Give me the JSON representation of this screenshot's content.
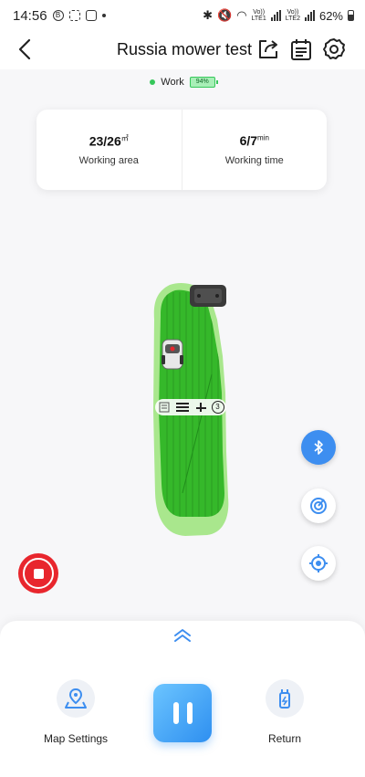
{
  "status_bar": {
    "time": "14:56",
    "battery_percent": "62%",
    "sim1_label": "Vo))\nLTE1",
    "sim2_label": "Vo))\nLTE2"
  },
  "header": {
    "title": "Russia mower test",
    "back_icon": "chevron-left-icon",
    "share_icon": "share-icon",
    "schedule_icon": "schedule-icon",
    "settings_icon": "gear-icon"
  },
  "device_status": {
    "state": "Work",
    "battery": "94%",
    "battery_level": 0.94,
    "state_color": "#36c75b"
  },
  "stats": {
    "area_value": "23/26",
    "area_unit": "㎡",
    "area_label": "Working area",
    "time_value": "6/7",
    "time_unit": "min",
    "time_label": "Working time"
  },
  "map": {
    "lawn_color": "#35b82a",
    "coverage_color": "#9be47a",
    "toolbar_icons": [
      "list-icon",
      "menu-icon",
      "mowing-pattern-icon",
      "info-icon"
    ],
    "toolbar_info": "3"
  },
  "map_controls": {
    "bluetooth_icon": "bluetooth-icon",
    "radar_icon": "radar-icon",
    "locate_icon": "locate-icon",
    "accent_color": "#3d8ef0"
  },
  "stop_button": {
    "icon": "stop-icon",
    "color": "#e8262d"
  },
  "bottom": {
    "expand_icon": "double-chevron-up-icon",
    "map_settings_label": "Map Settings",
    "return_label": "Return",
    "pause_icon": "pause-icon"
  }
}
